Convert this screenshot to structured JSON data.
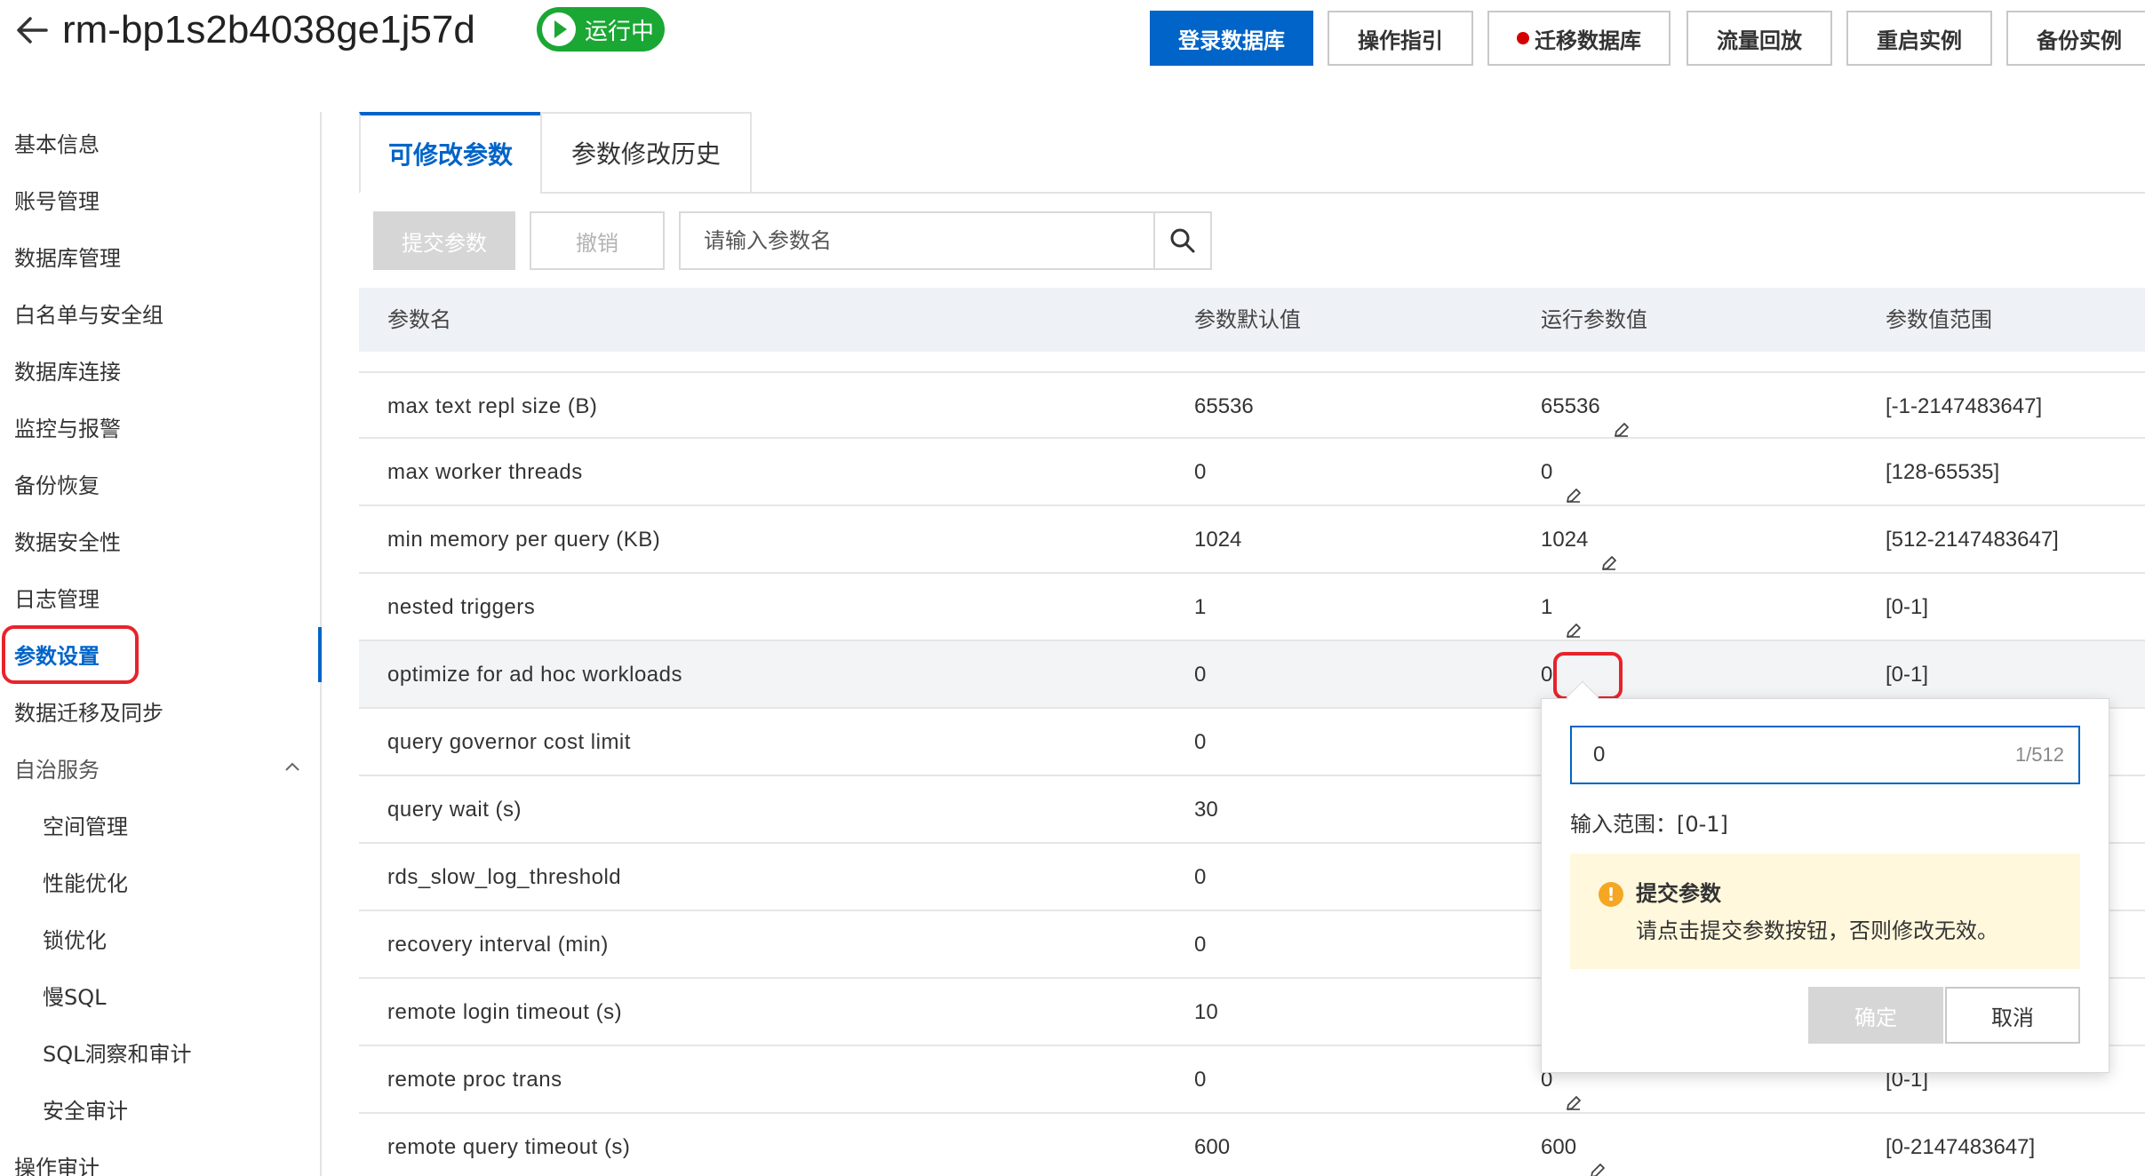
{
  "header": {
    "instance_id": "rm-bp1s2b4038ge1j57d",
    "status": "运行中",
    "actions": [
      "登录数据库",
      "操作指引",
      "迁移数据库",
      "流量回放",
      "重启实例",
      "备份实例"
    ]
  },
  "sidebar": {
    "items": [
      "基本信息",
      "账号管理",
      "数据库管理",
      "白名单与安全组",
      "数据库连接",
      "监控与报警",
      "备份恢复",
      "数据安全性",
      "日志管理",
      "参数设置",
      "数据迁移及同步",
      "自治服务"
    ],
    "sub_items": [
      "空间管理",
      "性能优化",
      "锁优化",
      "慢SQL",
      "SQL洞察和审计",
      "安全审计"
    ],
    "bottom_item": "操作审计",
    "active": "参数设置"
  },
  "tabs": [
    "可修改参数",
    "参数修改历史"
  ],
  "action_bar": {
    "submit_label": "提交参数",
    "cancel_label": "撤销",
    "search_placeholder": "请输入参数名"
  },
  "table": {
    "columns": [
      "参数名",
      "参数默认值",
      "运行参数值",
      "参数值范围"
    ],
    "rows": [
      {
        "name": "max text repl size (B)",
        "default": "65536",
        "running": "65536",
        "range": "[-1-2147483647]"
      },
      {
        "name": "max worker threads",
        "default": "0",
        "running": "0",
        "range": "[128-65535]"
      },
      {
        "name": "min memory per query (KB)",
        "default": "1024",
        "running": "1024",
        "range": "[512-2147483647]"
      },
      {
        "name": "nested triggers",
        "default": "1",
        "running": "1",
        "range": "[0-1]"
      },
      {
        "name": "optimize for ad hoc workloads",
        "default": "0",
        "running": "0",
        "range": "[0-1]"
      },
      {
        "name": "query governor cost limit",
        "default": "0",
        "running": "",
        "range": ""
      },
      {
        "name": "query wait (s)",
        "default": "30",
        "running": "",
        "range": ""
      },
      {
        "name": "rds_slow_log_threshold",
        "default": "0",
        "running": "",
        "range": ""
      },
      {
        "name": "recovery interval (min)",
        "default": "0",
        "running": "",
        "range": ""
      },
      {
        "name": "remote login timeout (s)",
        "default": "10",
        "running": "",
        "range": ""
      },
      {
        "name": "remote proc trans",
        "default": "0",
        "running": "0",
        "range": "[0-1]"
      },
      {
        "name": "remote query timeout (s)",
        "default": "600",
        "running": "600",
        "range": "[0-2147483647]"
      }
    ]
  },
  "popover": {
    "input_value": "0",
    "char_count": "1/512",
    "range_text": "输入范围：[0-1]",
    "warning_title": "提交参数",
    "warning_text": "请点击提交参数按钮，否则修改无效。",
    "ok_label": "确定",
    "cancel_label": "取消"
  },
  "colors": {
    "primary": "#0064c8",
    "running_status": "#1aa734",
    "highlight": "#e8232b",
    "warning_bg": "#fff8dc",
    "warning_icon": "#f5a623"
  }
}
